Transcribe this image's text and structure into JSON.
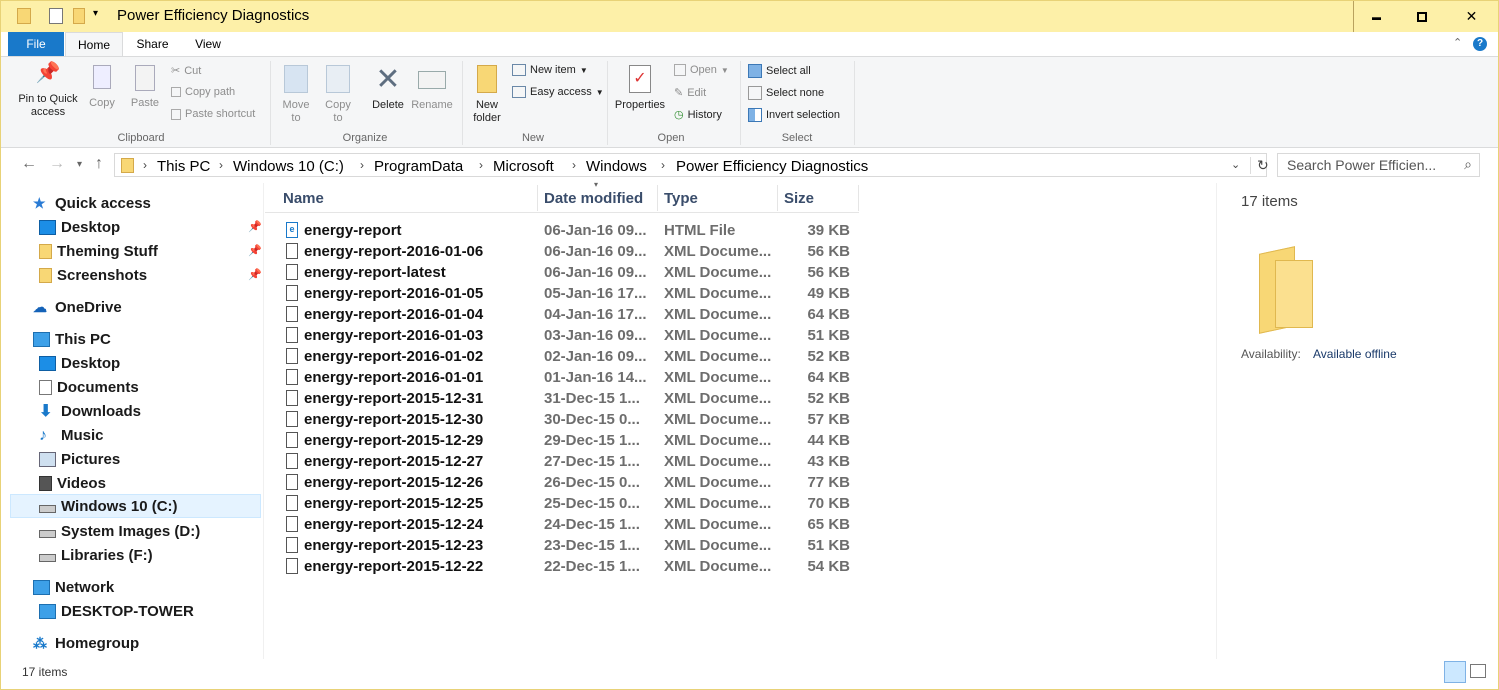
{
  "window": {
    "title": "Power Efficiency Diagnostics",
    "controls": {
      "minimize": "▬",
      "maximize": "□",
      "close": "✕"
    }
  },
  "menu_tabs": {
    "file": "File",
    "home": "Home",
    "share": "Share",
    "view": "View"
  },
  "ribbon": {
    "clipboard": {
      "pin": "Pin to Quick access",
      "copy": "Copy",
      "paste": "Paste",
      "cut": "Cut",
      "copy_path": "Copy path",
      "paste_shortcut": "Paste shortcut",
      "group": "Clipboard"
    },
    "organize": {
      "move_to": "Move to",
      "copy_to": "Copy to",
      "delete": "Delete",
      "rename": "Rename",
      "group": "Organize"
    },
    "new": {
      "new_folder": "New folder",
      "new_item": "New item",
      "easy_access": "Easy access",
      "group": "New"
    },
    "open": {
      "properties": "Properties",
      "open": "Open",
      "edit": "Edit",
      "history": "History",
      "group": "Open"
    },
    "select": {
      "select_all": "Select all",
      "select_none": "Select none",
      "invert_selection": "Invert selection",
      "group": "Select"
    }
  },
  "address": {
    "crumbs": [
      "This PC",
      "Windows 10 (C:)",
      "ProgramData",
      "Microsoft",
      "Windows",
      "Power Efficiency Diagnostics"
    ],
    "search_placeholder": "Search Power Efficien..."
  },
  "nav": {
    "quick_access": "Quick access",
    "qa_items": [
      "Desktop",
      "Theming Stuff",
      "Screenshots"
    ],
    "onedrive": "OneDrive",
    "this_pc": "This PC",
    "pc_items": [
      "Desktop",
      "Documents",
      "Downloads",
      "Music",
      "Pictures",
      "Videos",
      "Windows 10 (C:)",
      "System Images (D:)",
      "Libraries (F:)"
    ],
    "network": "Network",
    "network_items": [
      "DESKTOP-TOWER"
    ],
    "homegroup": "Homegroup"
  },
  "columns": {
    "name": "Name",
    "date": "Date modified",
    "type": "Type",
    "size": "Size"
  },
  "files": [
    {
      "name": "energy-report",
      "date": "06-Jan-16 09...",
      "type": "HTML File",
      "size": "39 KB"
    },
    {
      "name": "energy-report-2016-01-06",
      "date": "06-Jan-16 09...",
      "type": "XML Docume...",
      "size": "56 KB"
    },
    {
      "name": "energy-report-latest",
      "date": "06-Jan-16 09...",
      "type": "XML Docume...",
      "size": "56 KB"
    },
    {
      "name": "energy-report-2016-01-05",
      "date": "05-Jan-16 17...",
      "type": "XML Docume...",
      "size": "49 KB"
    },
    {
      "name": "energy-report-2016-01-04",
      "date": "04-Jan-16 17...",
      "type": "XML Docume...",
      "size": "64 KB"
    },
    {
      "name": "energy-report-2016-01-03",
      "date": "03-Jan-16 09...",
      "type": "XML Docume...",
      "size": "51 KB"
    },
    {
      "name": "energy-report-2016-01-02",
      "date": "02-Jan-16 09...",
      "type": "XML Docume...",
      "size": "52 KB"
    },
    {
      "name": "energy-report-2016-01-01",
      "date": "01-Jan-16 14...",
      "type": "XML Docume...",
      "size": "64 KB"
    },
    {
      "name": "energy-report-2015-12-31",
      "date": "31-Dec-15 1...",
      "type": "XML Docume...",
      "size": "52 KB"
    },
    {
      "name": "energy-report-2015-12-30",
      "date": "30-Dec-15 0...",
      "type": "XML Docume...",
      "size": "57 KB"
    },
    {
      "name": "energy-report-2015-12-29",
      "date": "29-Dec-15 1...",
      "type": "XML Docume...",
      "size": "44 KB"
    },
    {
      "name": "energy-report-2015-12-27",
      "date": "27-Dec-15 1...",
      "type": "XML Docume...",
      "size": "43 KB"
    },
    {
      "name": "energy-report-2015-12-26",
      "date": "26-Dec-15 0...",
      "type": "XML Docume...",
      "size": "77 KB"
    },
    {
      "name": "energy-report-2015-12-25",
      "date": "25-Dec-15 0...",
      "type": "XML Docume...",
      "size": "70 KB"
    },
    {
      "name": "energy-report-2015-12-24",
      "date": "24-Dec-15 1...",
      "type": "XML Docume...",
      "size": "65 KB"
    },
    {
      "name": "energy-report-2015-12-23",
      "date": "23-Dec-15 1...",
      "type": "XML Docume...",
      "size": "51 KB"
    },
    {
      "name": "energy-report-2015-12-22",
      "date": "22-Dec-15 1...",
      "type": "XML Docume...",
      "size": "54 KB"
    }
  ],
  "details": {
    "count": "17 items",
    "availability_label": "Availability:",
    "availability_value": "Available offline"
  },
  "status": {
    "items": "17 items"
  },
  "colors": {
    "titlebar": "#fdf0a8",
    "accent": "#1979ca",
    "folder": "#f8d775",
    "selected_nav": "#e5f3ff"
  }
}
